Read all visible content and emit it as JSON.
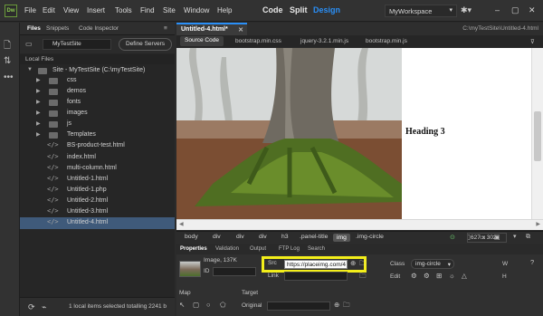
{
  "menubar": {
    "logo": "Dw",
    "items": [
      "File",
      "Edit",
      "View",
      "Insert",
      "Tools",
      "Find",
      "Site",
      "Window",
      "Help"
    ],
    "views": [
      "Code",
      "Split",
      "Design"
    ],
    "workspace": "MyWorkspace"
  },
  "filespanel": {
    "tabs": [
      "Files",
      "Snippets",
      "Code Inspector"
    ],
    "site_select": "MyTestSite",
    "define_servers": "Define Servers",
    "local_files": "Local Files",
    "tree": [
      {
        "label": "Site - MyTestSite (C:\\myTestSite)",
        "type": "root"
      },
      {
        "label": "css",
        "type": "folder"
      },
      {
        "label": "demos",
        "type": "folder"
      },
      {
        "label": "fonts",
        "type": "folder"
      },
      {
        "label": "images",
        "type": "folder"
      },
      {
        "label": "js",
        "type": "folder"
      },
      {
        "label": "Templates",
        "type": "folder"
      },
      {
        "label": "BS-product-test.html",
        "type": "file"
      },
      {
        "label": "index.html",
        "type": "file"
      },
      {
        "label": "multi-column.html",
        "type": "file"
      },
      {
        "label": "Untitled-1.html",
        "type": "file"
      },
      {
        "label": "Untitled-1.php",
        "type": "file"
      },
      {
        "label": "Untitled-2.html",
        "type": "file"
      },
      {
        "label": "Untitled-3.html",
        "type": "file"
      },
      {
        "label": "Untitled-4.html",
        "type": "file",
        "selected": true
      }
    ],
    "status": "1 local items selected totalling 2241 b"
  },
  "document": {
    "tab": "Untitled-4.html*",
    "path": "C:\\myTestSite\\Untitled-4.html",
    "related_files": [
      "Source Code",
      "bootstrap.min.css",
      "jquery-3.2.1.min.js",
      "bootstrap.min.js"
    ],
    "heading": "Heading 3"
  },
  "tagbar": {
    "tags": [
      "body",
      "div",
      "div",
      "div",
      "h3",
      ".panel-title",
      "img",
      ".img-circle"
    ],
    "dims": "627 x 302"
  },
  "properties": {
    "tabs": [
      "Properties",
      "Validation",
      "Output",
      "FTP Log",
      "Search"
    ],
    "image_label": "Image, 137K",
    "id_label": "ID",
    "src_label": "Src",
    "src_value": "https://placeimg.com/4",
    "link_label": "Link",
    "class_label": "Class",
    "class_value": "img-circle",
    "edit_label": "Edit",
    "w_label": "W",
    "h_label": "H",
    "map_label": "Map",
    "target_label": "Target",
    "original_label": "Original"
  }
}
